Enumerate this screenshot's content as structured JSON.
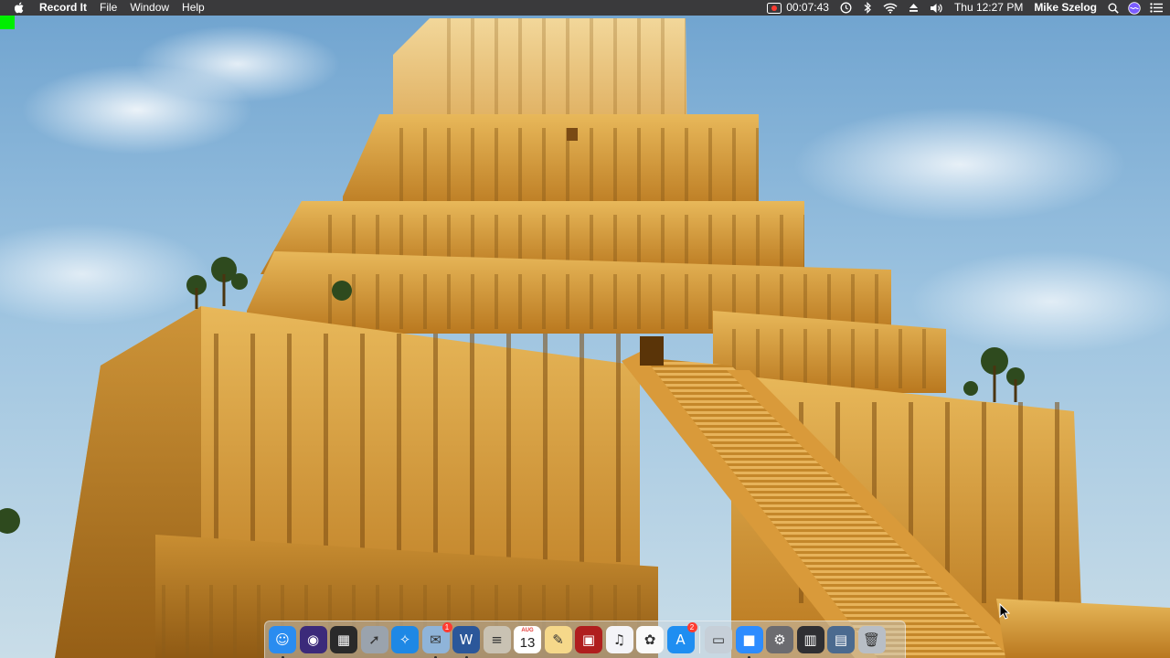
{
  "menubar": {
    "app_name": "Record It",
    "menus": [
      "File",
      "Window",
      "Help"
    ],
    "recording_time": "00:07:43",
    "clock": "Thu 12:27 PM",
    "user_name": "Mike Szelog",
    "status_icons": [
      "record-icon",
      "time-machine-icon",
      "bluetooth-icon",
      "wifi-icon",
      "eject-icon",
      "volume-icon",
      "search-icon",
      "siri-icon",
      "notification-center-icon"
    ]
  },
  "dock": {
    "items": [
      {
        "name": "finder-icon",
        "glyph": "☺",
        "bg": "#2a8cf0",
        "running": true
      },
      {
        "name": "siri-icon",
        "glyph": "◉",
        "bg": "#3b2a7a"
      },
      {
        "name": "mission-control-icon",
        "glyph": "▦",
        "bg": "#2a2a2a"
      },
      {
        "name": "launchpad-icon",
        "glyph": "➚",
        "bg": "#9aa3ad"
      },
      {
        "name": "safari-icon",
        "glyph": "✧",
        "bg": "#1e88e5"
      },
      {
        "name": "mail-icon",
        "glyph": "✉",
        "bg": "#8fb4d9",
        "badge": "1",
        "running": true
      },
      {
        "name": "word-icon",
        "glyph": "W",
        "bg": "#2b579a",
        "running": true
      },
      {
        "name": "notes-icon",
        "glyph": "≡",
        "bg": "#c9c2b3"
      },
      {
        "name": "calendar-icon",
        "glyph": "",
        "bg": "#ffffff",
        "calendar_month": "AUG",
        "calendar_day": "13"
      },
      {
        "name": "preview-icon",
        "glyph": "✎",
        "bg": "#f5d88a"
      },
      {
        "name": "photo-booth-icon",
        "glyph": "▣",
        "bg": "#b01e1e"
      },
      {
        "name": "itunes-icon",
        "glyph": "♫",
        "bg": "#f4f4f8"
      },
      {
        "name": "photos-icon",
        "glyph": "✿",
        "bg": "#fafafa"
      },
      {
        "name": "app-store-icon",
        "glyph": "A",
        "bg": "#1f8ef1",
        "badge": "2"
      },
      {
        "name": "image-capture-icon",
        "glyph": "▭",
        "bg": "#c6cfd8"
      },
      {
        "name": "zoom-icon",
        "glyph": "■",
        "bg": "#2d8cff",
        "running": true
      },
      {
        "name": "system-preferences-icon",
        "glyph": "⚙",
        "bg": "#6c6c70"
      },
      {
        "name": "activity-monitor-icon",
        "glyph": "▥",
        "bg": "#2f2f33"
      },
      {
        "name": "utilities-folder-icon",
        "glyph": "▤",
        "bg": "#4b6a8f"
      },
      {
        "name": "trash-icon",
        "glyph": "🗑",
        "bg": "#b8bec6"
      }
    ]
  }
}
